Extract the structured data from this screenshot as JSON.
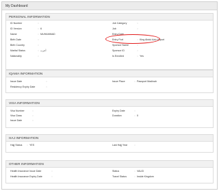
{
  "page": {
    "title": "My Dashboard"
  },
  "personal": {
    "header": "PERSONAL INFORMATION",
    "left": [
      {
        "label": "ID Number",
        "value": ""
      },
      {
        "label": "ID Version",
        "value": "6"
      },
      {
        "label": "Name",
        "value": "MUHAMMAD"
      },
      {
        "label": "Birth Date",
        "value": ""
      },
      {
        "label": "Birth Country",
        "value": ""
      },
      {
        "label": "Marital Status",
        "value": "أعزب"
      },
      {
        "label": "Nationality",
        "value": ""
      }
    ],
    "right": [
      {
        "label": "Job Category",
        "value": ""
      },
      {
        "label": "Job",
        "value": ""
      },
      {
        "label": "Entry Date",
        "value": ""
      },
      {
        "label": "Entry Port",
        "value": "King Abdul Aziz Airport"
      },
      {
        "label": "Sponsor Name",
        "value": ""
      },
      {
        "label": "Sponsor ID",
        "value": ""
      },
      {
        "label": "Is Enrolled",
        "value": "Yes"
      }
    ]
  },
  "iqama": {
    "header": "IQAMA INFORMATION",
    "left": [
      {
        "label": "Issue Date",
        "value": ""
      },
      {
        "label": "Residency Expiry Date",
        "value": ""
      }
    ],
    "right": [
      {
        "label": "Issue Place",
        "value": "Passport Madinah"
      }
    ]
  },
  "visa": {
    "header": "VISA INFORMATION",
    "left": [
      {
        "label": "Visa Number",
        "value": ""
      },
      {
        "label": "Visa Class",
        "value": ""
      },
      {
        "label": "Issue Date",
        "value": ""
      }
    ],
    "right": [
      {
        "label": "Expiry Date",
        "value": ""
      },
      {
        "label": "Duration",
        "value": "0"
      }
    ]
  },
  "hajj": {
    "header": "HAJ INFORMATION",
    "left": [
      {
        "label": "Hajj Status",
        "value": "YES"
      }
    ],
    "right": [
      {
        "label": "Last Hajj Year",
        "value": ""
      }
    ]
  },
  "other": {
    "header": "OTHER INFORMATION",
    "left": [
      {
        "label": "Health Insurance Issue Date",
        "value": ""
      },
      {
        "label": "Health Insurance Expiry Date",
        "value": ""
      }
    ],
    "right": [
      {
        "label": "Status",
        "value": "VALID"
      },
      {
        "label": "Travel Status",
        "value": "Inside Kingdom"
      }
    ]
  },
  "annotation": {
    "color": "#e21b1b"
  }
}
